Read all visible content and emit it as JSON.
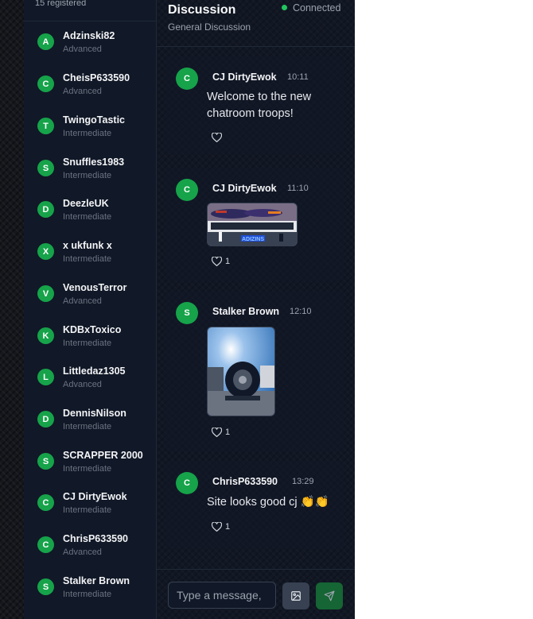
{
  "sidebar": {
    "registered_text": "15 registered",
    "users": [
      {
        "initial": "A",
        "name": "Adzinski82",
        "level": "Advanced"
      },
      {
        "initial": "C",
        "name": "CheisP633590",
        "level": "Advanced"
      },
      {
        "initial": "T",
        "name": "TwingoTastic",
        "level": "Intermediate"
      },
      {
        "initial": "S",
        "name": "Snuffles1983",
        "level": "Intermediate"
      },
      {
        "initial": "D",
        "name": "DeezleUK",
        "level": "Intermediate"
      },
      {
        "initial": "X",
        "name": "x ukfunk x",
        "level": "Intermediate"
      },
      {
        "initial": "V",
        "name": "VenousTerror",
        "level": "Advanced"
      },
      {
        "initial": "K",
        "name": "KDBxToxico",
        "level": "Intermediate"
      },
      {
        "initial": "L",
        "name": "Littledaz1305",
        "level": "Advanced"
      },
      {
        "initial": "D",
        "name": "DennisNilson",
        "level": "Intermediate"
      },
      {
        "initial": "S",
        "name": "SCRAPPER 2000",
        "level": "Intermediate"
      },
      {
        "initial": "C",
        "name": "CJ DirtyEwok",
        "level": "Intermediate"
      },
      {
        "initial": "C",
        "name": "ChrisP633590",
        "level": "Advanced"
      },
      {
        "initial": "S",
        "name": "Stalker Brown",
        "level": "Intermediate"
      }
    ]
  },
  "chat": {
    "title": "Discussion",
    "subtitle": "General Discussion",
    "status": "Connected",
    "colors": {
      "accent": "#16a34a",
      "status_dot": "#22c55e"
    },
    "messages": [
      {
        "initial": "C",
        "author": "CJ DirtyEwok",
        "time": "10:11",
        "text": "Welcome to the new chatroom troops!",
        "likes": ""
      },
      {
        "initial": "C",
        "author": "CJ DirtyEwok",
        "time": "11:10",
        "image": "race-cars-photo",
        "likes": "1"
      },
      {
        "initial": "S",
        "author": "Stalker Brown",
        "time": "12:10",
        "image": "wheel-photo",
        "likes": "1"
      },
      {
        "initial": "C",
        "author": "ChrisP633590",
        "time": "13:29",
        "text": "Site looks good cj 👏👏",
        "likes": "1"
      }
    ]
  },
  "composer": {
    "placeholder": "Type a message,",
    "image_button_icon": "image-icon",
    "send_button_icon": "send-icon"
  }
}
